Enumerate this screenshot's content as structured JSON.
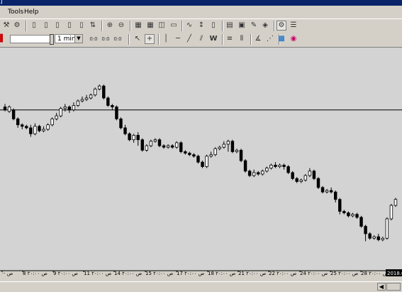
{
  "window": {
    "title_fragment": "]"
  },
  "menu": [
    "Tools",
    "Help"
  ],
  "toolbar": {
    "timeframe_value": "1 min",
    "icons_row1": [
      "tool-icon",
      "script-icon",
      "new-doc-icon",
      "doc-icon",
      "doc-icon",
      "doc-icon",
      "doc-icon",
      "doc-icon",
      "export-icon",
      "zoom-in-icon",
      "zoom-out-icon",
      "tile-icon",
      "tile-icon",
      "window-icon",
      "panel-icon",
      "line-icon",
      "cursor-icon",
      "object-icon",
      "chart-icon",
      "save-icon",
      "brush-icon",
      "cube-icon",
      "gear-icon",
      "list-icon"
    ],
    "icons_row2": [
      "stop-icon",
      "cursor-arrow-icon",
      "crosshair-icon",
      "vertical-line-icon",
      "horizontal-line-icon",
      "trend-line-icon",
      "channel-icon",
      "wave-icon",
      "lines-icon",
      "fibo-icon",
      "fan-icon",
      "palette-icon",
      "color-icon"
    ]
  },
  "chart_data": {
    "type": "candlestick",
    "x_labels": [
      "·· ص",
      "8 ۲۰:۰۰ ص",
      "9 ۲۰:۰۰ ص",
      "11 ۲۰:۰۰ ص",
      "14 ۲۰:۰۰ ص",
      "15 ۲۰:۰۰ ص",
      "17 ۲۰:۰۰ ص",
      "18 ۲۰:۰۰ ص",
      "21 ۲۰:۰۰ ص",
      "22 ۲۰:۰۰ ص",
      "24 ۲۰:۰۰ ص",
      "25 ۲۰:۰۰ ص",
      "28 ۲۰:۰۰ ص",
      "2018.0"
    ],
    "horizontal_level": 0.58,
    "candles": [
      [
        0.6,
        0.58,
        0.62,
        0.57
      ],
      [
        0.57,
        0.6,
        0.61,
        0.56
      ],
      [
        0.58,
        0.52,
        0.59,
        0.51
      ],
      [
        0.52,
        0.48,
        0.53,
        0.46
      ],
      [
        0.48,
        0.47,
        0.49,
        0.45
      ],
      [
        0.47,
        0.46,
        0.48,
        0.45
      ],
      [
        0.46,
        0.42,
        0.48,
        0.4
      ],
      [
        0.42,
        0.47,
        0.49,
        0.41
      ],
      [
        0.47,
        0.44,
        0.48,
        0.43
      ],
      [
        0.44,
        0.45,
        0.47,
        0.43
      ],
      [
        0.45,
        0.48,
        0.49,
        0.44
      ],
      [
        0.48,
        0.52,
        0.53,
        0.47
      ],
      [
        0.52,
        0.54,
        0.56,
        0.51
      ],
      [
        0.54,
        0.59,
        0.6,
        0.53
      ],
      [
        0.59,
        0.6,
        0.62,
        0.57
      ],
      [
        0.6,
        0.58,
        0.61,
        0.56
      ],
      [
        0.58,
        0.61,
        0.63,
        0.57
      ],
      [
        0.61,
        0.64,
        0.65,
        0.6
      ],
      [
        0.64,
        0.65,
        0.67,
        0.63
      ],
      [
        0.65,
        0.66,
        0.68,
        0.64
      ],
      [
        0.66,
        0.68,
        0.69,
        0.65
      ],
      [
        0.68,
        0.72,
        0.73,
        0.67
      ],
      [
        0.72,
        0.74,
        0.75,
        0.71
      ],
      [
        0.74,
        0.66,
        0.75,
        0.65
      ],
      [
        0.66,
        0.61,
        0.67,
        0.6
      ],
      [
        0.61,
        0.6,
        0.62,
        0.58
      ],
      [
        0.6,
        0.52,
        0.61,
        0.51
      ],
      [
        0.52,
        0.46,
        0.53,
        0.45
      ],
      [
        0.46,
        0.42,
        0.48,
        0.41
      ],
      [
        0.42,
        0.38,
        0.43,
        0.37
      ],
      [
        0.38,
        0.41,
        0.42,
        0.36
      ],
      [
        0.41,
        0.38,
        0.43,
        0.34
      ],
      [
        0.38,
        0.31,
        0.39,
        0.3
      ],
      [
        0.31,
        0.34,
        0.35,
        0.3
      ],
      [
        0.34,
        0.37,
        0.38,
        0.33
      ],
      [
        0.37,
        0.38,
        0.39,
        0.36
      ],
      [
        0.38,
        0.34,
        0.39,
        0.33
      ],
      [
        0.34,
        0.33,
        0.35,
        0.32
      ],
      [
        0.33,
        0.34,
        0.35,
        0.32
      ],
      [
        0.34,
        0.33,
        0.35,
        0.32
      ],
      [
        0.33,
        0.36,
        0.37,
        0.32
      ],
      [
        0.36,
        0.3,
        0.37,
        0.29
      ],
      [
        0.3,
        0.29,
        0.31,
        0.28
      ],
      [
        0.29,
        0.28,
        0.3,
        0.27
      ],
      [
        0.28,
        0.27,
        0.29,
        0.26
      ],
      [
        0.27,
        0.23,
        0.28,
        0.22
      ],
      [
        0.23,
        0.2,
        0.24,
        0.19
      ],
      [
        0.2,
        0.27,
        0.28,
        0.19
      ],
      [
        0.27,
        0.28,
        0.3,
        0.26
      ],
      [
        0.28,
        0.32,
        0.33,
        0.27
      ],
      [
        0.32,
        0.33,
        0.34,
        0.31
      ],
      [
        0.33,
        0.35,
        0.37,
        0.32
      ],
      [
        0.35,
        0.37,
        0.38,
        0.3
      ],
      [
        0.37,
        0.3,
        0.38,
        0.29
      ],
      [
        0.3,
        0.31,
        0.32,
        0.29
      ],
      [
        0.31,
        0.24,
        0.32,
        0.23
      ],
      [
        0.24,
        0.17,
        0.25,
        0.16
      ],
      [
        0.17,
        0.14,
        0.18,
        0.13
      ],
      [
        0.14,
        0.16,
        0.18,
        0.13
      ],
      [
        0.16,
        0.15,
        0.17,
        0.14
      ],
      [
        0.15,
        0.17,
        0.18,
        0.14
      ],
      [
        0.17,
        0.19,
        0.2,
        0.16
      ],
      [
        0.19,
        0.21,
        0.22,
        0.18
      ],
      [
        0.21,
        0.2,
        0.23,
        0.19
      ],
      [
        0.2,
        0.21,
        0.22,
        0.19
      ],
      [
        0.21,
        0.2,
        0.22,
        0.18
      ],
      [
        0.2,
        0.16,
        0.21,
        0.15
      ],
      [
        0.16,
        0.12,
        0.17,
        0.11
      ],
      [
        0.12,
        0.1,
        0.13,
        0.09
      ],
      [
        0.1,
        0.11,
        0.12,
        0.09
      ],
      [
        0.11,
        0.14,
        0.15,
        0.1
      ],
      [
        0.14,
        0.17,
        0.19,
        0.13
      ],
      [
        0.17,
        0.12,
        0.18,
        0.11
      ],
      [
        0.12,
        0.06,
        0.13,
        0.05
      ],
      [
        0.06,
        0.03,
        0.07,
        0.02
      ],
      [
        0.03,
        0.04,
        0.05,
        0.02
      ],
      [
        0.04,
        0.03,
        0.06,
        0.02
      ],
      [
        0.03,
        -0.02,
        0.04,
        -0.04
      ],
      [
        -0.02,
        -0.1,
        -0.01,
        -0.12
      ],
      [
        -0.1,
        -0.11,
        -0.09,
        -0.12
      ],
      [
        -0.11,
        -0.13,
        -0.1,
        -0.14
      ],
      [
        -0.13,
        -0.12,
        -0.11,
        -0.14
      ],
      [
        -0.12,
        -0.14,
        -0.11,
        -0.15
      ],
      [
        -0.14,
        -0.2,
        -0.13,
        -0.21
      ],
      [
        -0.2,
        -0.25,
        -0.19,
        -0.3
      ],
      [
        -0.25,
        -0.28,
        -0.24,
        -0.29
      ],
      [
        -0.28,
        -0.27,
        -0.26,
        -0.29
      ],
      [
        -0.27,
        -0.29,
        -0.25,
        -0.3
      ],
      [
        -0.29,
        -0.28,
        -0.27,
        -0.3
      ],
      [
        -0.28,
        -0.15,
        -0.14,
        -0.29
      ],
      [
        -0.15,
        -0.06,
        -0.05,
        -0.16
      ],
      [
        -0.06,
        -0.02,
        -0.01,
        -0.07
      ]
    ]
  }
}
